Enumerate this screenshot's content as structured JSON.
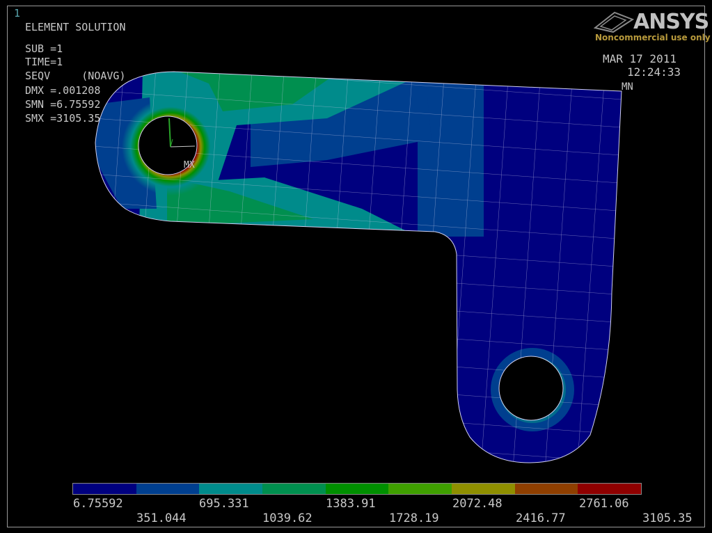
{
  "window_number": "1",
  "info": {
    "title": "ELEMENT SOLUTION",
    "sub": "SUB =1",
    "time": "TIME=1",
    "seqv": "SEQV     (NOAVG)",
    "dmx": "DMX =.001208",
    "smn": "SMN =6.75592",
    "smx": "SMX =3105.35"
  },
  "logo": {
    "name": "ANSYS",
    "note": "Noncommercial use only"
  },
  "date": "MAR 17 2011",
  "time_of_day": "12:24:33",
  "markers": {
    "mn": "MN",
    "mx": "MX"
  },
  "legend": {
    "colors": [
      "#00007f",
      "#003f8f",
      "#008b8b",
      "#008f4f",
      "#008f00",
      "#3f9f00",
      "#8f8f00",
      "#8f3f00",
      "#8f0000"
    ],
    "upper_labels": [
      "6.75592",
      "695.331",
      "1383.91",
      "2072.48",
      "2761.06"
    ],
    "lower_labels": [
      "351.044",
      "1039.62",
      "1728.19",
      "2416.77",
      "3105.35"
    ]
  },
  "icons": {
    "axis_triad": "xyz-triad-icon"
  }
}
